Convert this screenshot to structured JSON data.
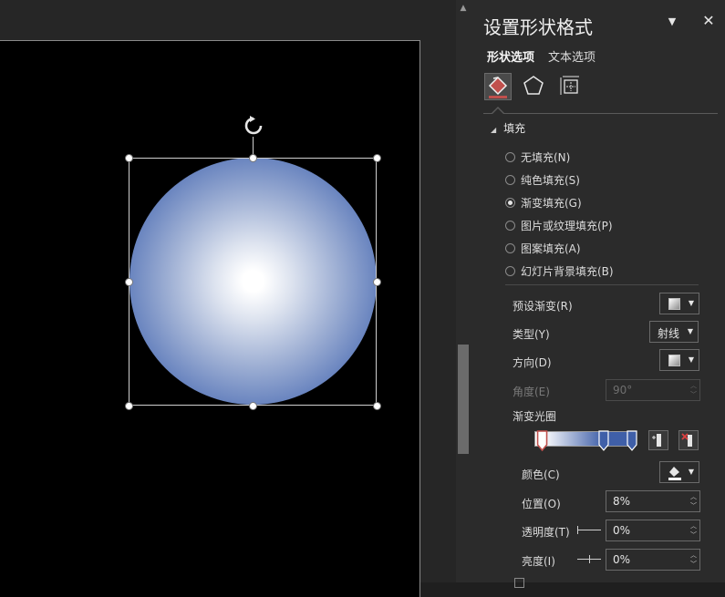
{
  "pane": {
    "title": "设置形状格式",
    "tabs": [
      {
        "label": "形状选项"
      },
      {
        "label": "文本选项"
      }
    ],
    "icon_tabs": [
      "fill-line-icon",
      "effects-pentagon-icon",
      "size-properties-icon"
    ],
    "section": "填充",
    "fill_options": [
      {
        "label": "无填充(N)",
        "checked": false
      },
      {
        "label": "纯色填充(S)",
        "checked": false
      },
      {
        "label": "渐变填充(G)",
        "checked": true
      },
      {
        "label": "图片或纹理填充(P)",
        "checked": false
      },
      {
        "label": "图案填充(A)",
        "checked": false
      },
      {
        "label": "幻灯片背景填充(B)",
        "checked": false
      }
    ],
    "preset_label": "预设渐变(R)",
    "type_label": "类型(Y)",
    "type_value": "射线",
    "direction_label": "方向(D)",
    "angle_label": "角度(E)",
    "angle_value": "90°",
    "stops_label": "渐变光圈",
    "stops": [
      {
        "position": 0.08,
        "color": "#ffffff"
      },
      {
        "position": 0.71,
        "color": "#3f5fa8"
      },
      {
        "position": 1.0,
        "color": "#3f5fa8"
      }
    ],
    "color_label": "颜色(C)",
    "position_label": "位置(O)",
    "position_value": "8%",
    "transparency_label": "透明度(T)",
    "transparency_value": "0%",
    "brightness_label": "亮度(I)",
    "brightness_value": "0%"
  },
  "colors": {
    "gradient_center": "#ffffff",
    "gradient_edge": "#3f5fa8",
    "accent": "#c0504d"
  }
}
